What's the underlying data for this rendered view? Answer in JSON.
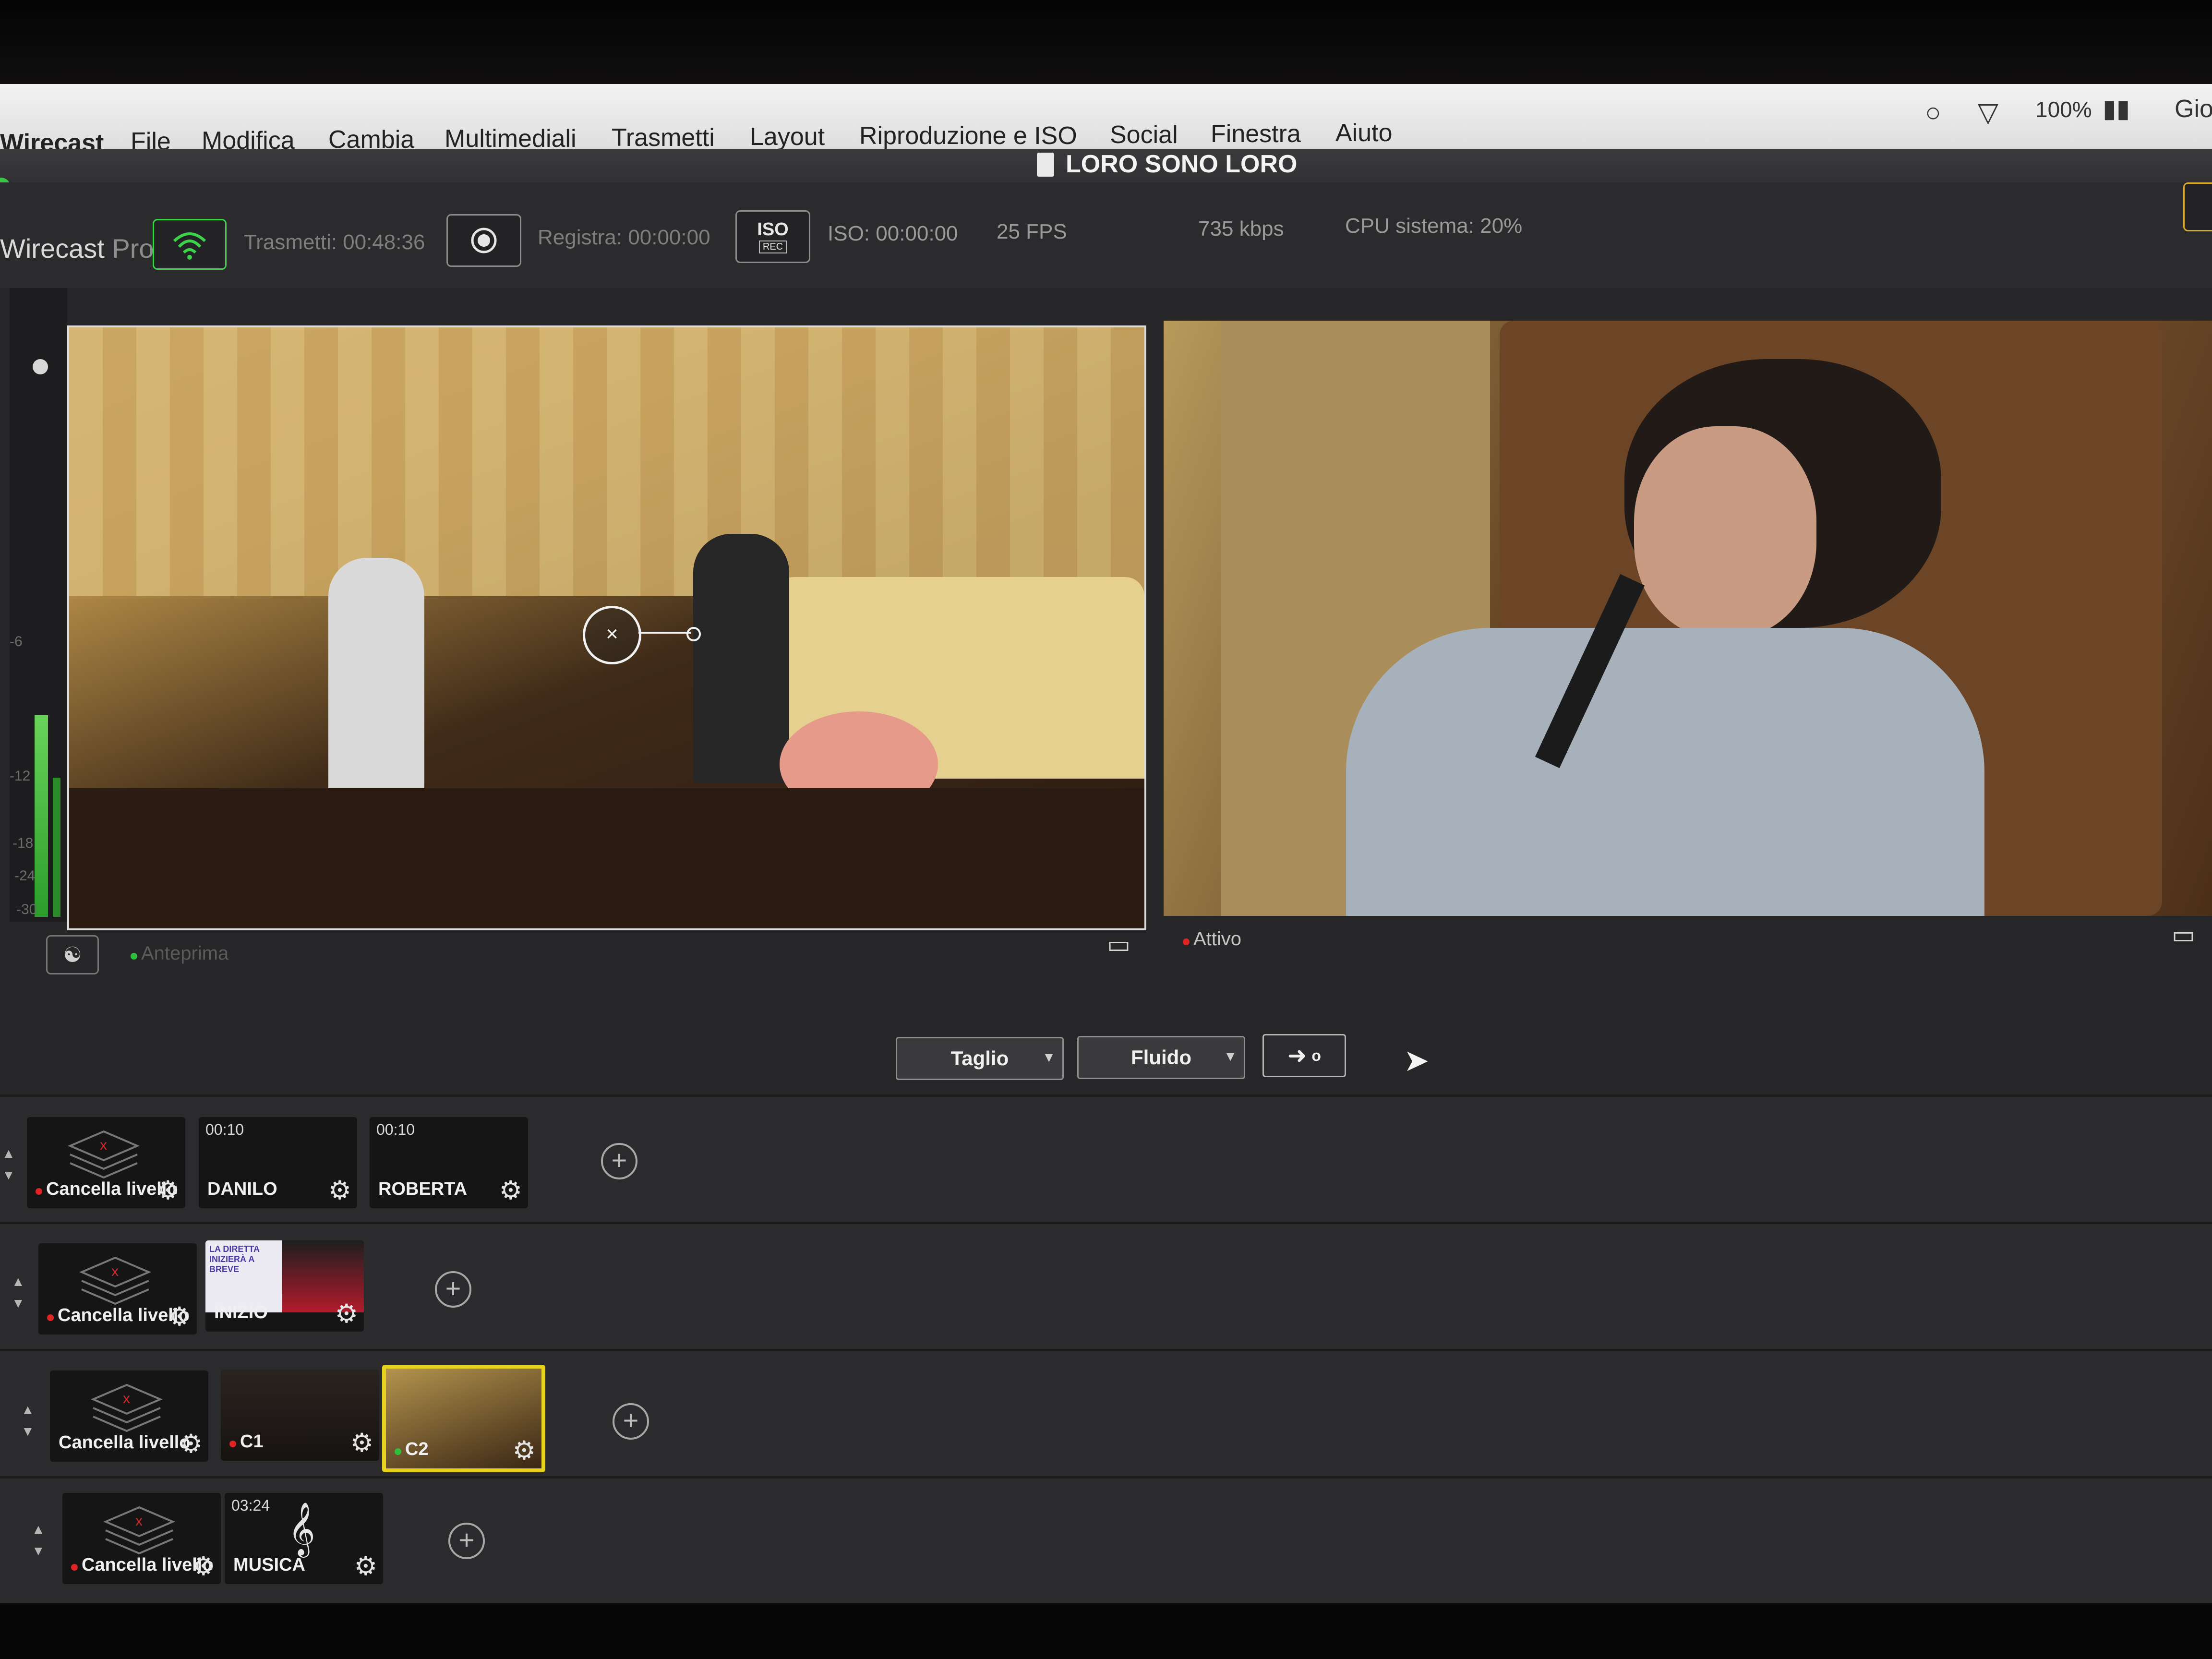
{
  "menubar": {
    "app": "Wirecast",
    "items": [
      "File",
      "Modifica",
      "Cambia",
      "Multimediali",
      "Trasmetti",
      "Layout",
      "Riproduzione e ISO",
      "Social",
      "Finestra",
      "Aiuto"
    ],
    "battery": "100%",
    "clock_partial": "Gio"
  },
  "window": {
    "title": "LORO SONO LORO"
  },
  "toolbar": {
    "app_name": "Wirecast",
    "app_edition": "Pro",
    "broadcast_label": "Trasmetti: 00:48:36",
    "record_label": "Registra: 00:00:00",
    "iso_badge_top": "ISO",
    "iso_badge_bottom": "REC",
    "iso_label": "ISO: 00:00:00",
    "fps": "25 FPS",
    "bitrate": "735 kbps",
    "cpu": "CPU sistema: 20%"
  },
  "monitors": {
    "preview_label": "Anteprima",
    "live_label": "Attivo"
  },
  "meter_ticks": [
    "-6",
    "-12",
    "-18",
    "-24",
    "-30"
  ],
  "transition": {
    "cut": "Taglio",
    "smooth": "Fluido",
    "go_dot": "o"
  },
  "layers": [
    {
      "shots": [
        {
          "name": "Cancella livello",
          "time": "",
          "status": "red"
        },
        {
          "name": "DANILO",
          "time": "00:10",
          "status": ""
        },
        {
          "name": "ROBERTA",
          "time": "00:10",
          "status": ""
        }
      ]
    },
    {
      "shots": [
        {
          "name": "Cancella livello",
          "time": "",
          "status": "red"
        },
        {
          "name": "INIZIO",
          "time": "",
          "status": "",
          "thumb_text": "LA DIRETTA INIZIERÀ A BREVE"
        }
      ]
    },
    {
      "shots": [
        {
          "name": "Cancella livello",
          "time": "",
          "status": ""
        },
        {
          "name": "C1",
          "time": "",
          "status": "red"
        },
        {
          "name": "C2",
          "time": "",
          "status": "green"
        }
      ]
    },
    {
      "shots": [
        {
          "name": "Cancella livello",
          "time": "",
          "status": "red"
        },
        {
          "name": "MUSICA",
          "time": "03:24",
          "status": ""
        }
      ]
    }
  ],
  "colors": {
    "accent_green": "#3cd34a",
    "live_red": "#e02424",
    "selected_yellow": "#e7d21c"
  }
}
